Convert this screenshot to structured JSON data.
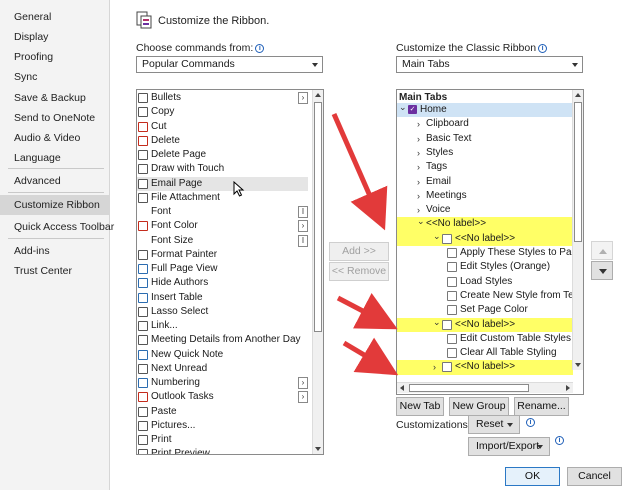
{
  "nav": {
    "items": [
      "General",
      "Display",
      "Proofing",
      "Sync",
      "Save & Backup",
      "Send to OneNote",
      "Audio & Video",
      "Language",
      "Advanced",
      "Customize Ribbon",
      "Quick Access Toolbar",
      "Add-ins",
      "Trust Center"
    ],
    "active": "Customize Ribbon"
  },
  "header": {
    "title": "Customize the Ribbon."
  },
  "left": {
    "choose_label": "Choose commands from:",
    "choose_value": "Popular Commands",
    "commands": [
      {
        "label": "Bullets",
        "submenu": true
      },
      {
        "label": "Copy"
      },
      {
        "label": "Cut"
      },
      {
        "label": "Delete"
      },
      {
        "label": "Delete Page"
      },
      {
        "label": "Draw with Touch"
      },
      {
        "label": "Email Page"
      },
      {
        "label": "File Attachment"
      },
      {
        "label": "Font",
        "picker": true
      },
      {
        "label": "Font Color",
        "submenu": true
      },
      {
        "label": "Font Size",
        "picker": true
      },
      {
        "label": "Format Painter"
      },
      {
        "label": "Full Page View"
      },
      {
        "label": "Hide Authors"
      },
      {
        "label": "Insert Table"
      },
      {
        "label": "Lasso Select"
      },
      {
        "label": "Link..."
      },
      {
        "label": "Meeting Details from Another Day"
      },
      {
        "label": "New Quick Note"
      },
      {
        "label": "Next Unread"
      },
      {
        "label": "Numbering",
        "submenu": true
      },
      {
        "label": "Outlook Tasks",
        "submenu": true
      },
      {
        "label": "Paste"
      },
      {
        "label": "Pictures..."
      },
      {
        "label": "Print"
      },
      {
        "label": "Print Preview"
      }
    ]
  },
  "middle": {
    "add": "Add >>",
    "remove": "<< Remove"
  },
  "right": {
    "customize_label": "Customize the Classic Ribbon",
    "customize_value": "Main Tabs",
    "tree_header": "Main Tabs",
    "tree": [
      {
        "label": "Home",
        "level": 0,
        "expanded": true,
        "checked": true
      },
      {
        "label": "Clipboard",
        "level": 1
      },
      {
        "label": "Basic Text",
        "level": 1
      },
      {
        "label": "Styles",
        "level": 1
      },
      {
        "label": "Tags",
        "level": 1
      },
      {
        "label": "Email",
        "level": 1
      },
      {
        "label": "Meetings",
        "level": 1
      },
      {
        "label": "Voice",
        "level": 1
      },
      {
        "label": "<<No label>>",
        "level": 1,
        "expanded": true,
        "highlight": true
      },
      {
        "label": "<<No label>>",
        "level": 2,
        "expanded": true,
        "highlight": true
      },
      {
        "label": "Apply These Styles to Page",
        "level": 3
      },
      {
        "label": "Edit Styles (Orange)",
        "level": 3
      },
      {
        "label": "Load Styles",
        "level": 3
      },
      {
        "label": "Create New Style from Text",
        "level": 3
      },
      {
        "label": "Set Page Color",
        "level": 3
      },
      {
        "label": "<<No label>>",
        "level": 2,
        "expanded": true,
        "highlight": true
      },
      {
        "label": "Edit Custom Table Styles",
        "level": 3
      },
      {
        "label": "Clear All Table Styling",
        "level": 3
      },
      {
        "label": "<<No label>>",
        "level": 2,
        "highlight": true
      }
    ],
    "new_tab": "New Tab",
    "new_group": "New Group",
    "rename": "Rename...",
    "customizations_label": "Customizations:",
    "reset": "Reset",
    "import_export": "Import/Export"
  },
  "footer": {
    "ok": "OK",
    "cancel": "Cancel"
  },
  "colors": {
    "highlight": "#ffff66",
    "arrow": "#e23a3a",
    "nav_active": "#d6d6d6"
  }
}
